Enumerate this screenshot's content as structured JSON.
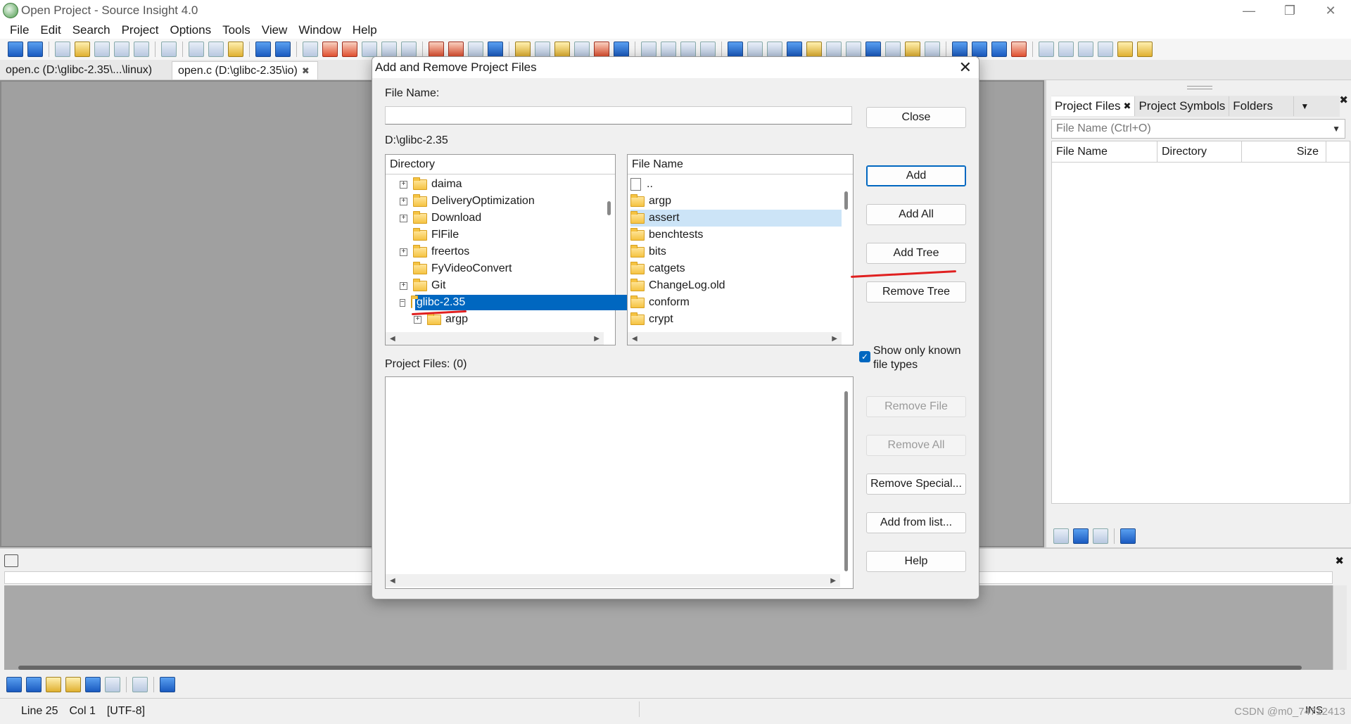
{
  "window": {
    "title": "Open Project - Source Insight 4.0",
    "controls": [
      "—",
      "❐",
      "✕"
    ]
  },
  "menu": [
    "File",
    "Edit",
    "Search",
    "Project",
    "Options",
    "Tools",
    "View",
    "Window",
    "Help"
  ],
  "tabs": [
    {
      "label": "open.c (D:\\glibc-2.35\\...\\linux)",
      "active": false
    },
    {
      "label": "open.c (D:\\glibc-2.35\\io)",
      "active": true,
      "close": "✖"
    }
  ],
  "right_panel": {
    "tabs": [
      {
        "label": "Project Files",
        "close": "✖"
      },
      {
        "label": "Project Symbols"
      },
      {
        "label": "Folders"
      }
    ],
    "dropdown": "▼",
    "close": "✖",
    "search_placeholder": "File Name (Ctrl+O)",
    "columns": [
      "File Name",
      "Directory",
      "Size"
    ]
  },
  "dialog": {
    "title": "Add and Remove Project Files",
    "close": "✕",
    "file_name_label": "File Name:",
    "file_name_value": "",
    "current_path": "D:\\glibc-2.35",
    "directory_header": "Directory",
    "directory_tree": [
      {
        "name": "daima",
        "expander": "+"
      },
      {
        "name": "DeliveryOptimization",
        "expander": "+"
      },
      {
        "name": "Download",
        "expander": "+"
      },
      {
        "name": "FlFile",
        "expander": ""
      },
      {
        "name": "freertos",
        "expander": "+"
      },
      {
        "name": "FyVideoConvert",
        "expander": ""
      },
      {
        "name": "Git",
        "expander": "+"
      },
      {
        "name": "glibc-2.35",
        "expander": "−",
        "selected": true
      },
      {
        "name": "argp",
        "expander": "+",
        "child": true
      }
    ],
    "file_name_header": "File Name",
    "file_list": [
      {
        "name": "..",
        "type": "file"
      },
      {
        "name": "argp",
        "type": "folder"
      },
      {
        "name": "assert",
        "type": "folder",
        "highlighted": true
      },
      {
        "name": "benchtests",
        "type": "folder"
      },
      {
        "name": "bits",
        "type": "folder"
      },
      {
        "name": "catgets",
        "type": "folder"
      },
      {
        "name": "ChangeLog.old",
        "type": "folder"
      },
      {
        "name": "conform",
        "type": "folder"
      },
      {
        "name": "crypt",
        "type": "folder"
      }
    ],
    "project_files_label": "Project Files: (0)",
    "show_known_types_label": "Show only known file types",
    "show_known_types_checked": true,
    "buttons": {
      "close": "Close",
      "add": "Add",
      "add_all": "Add All",
      "add_tree": "Add Tree",
      "remove_tree": "Remove Tree",
      "remove_file": "Remove File",
      "remove_all": "Remove All",
      "remove_special": "Remove Special...",
      "add_from_list": "Add from list...",
      "help": "Help"
    }
  },
  "status": {
    "line": "Line 25",
    "col": "Col 1",
    "encoding": "[UTF-8]",
    "ins": "INS",
    "watermark": "CSDN @m0_74712413"
  },
  "colors": {
    "selection": "#0067c0",
    "hover": "#cce4f7",
    "annotation": "#e02020"
  }
}
